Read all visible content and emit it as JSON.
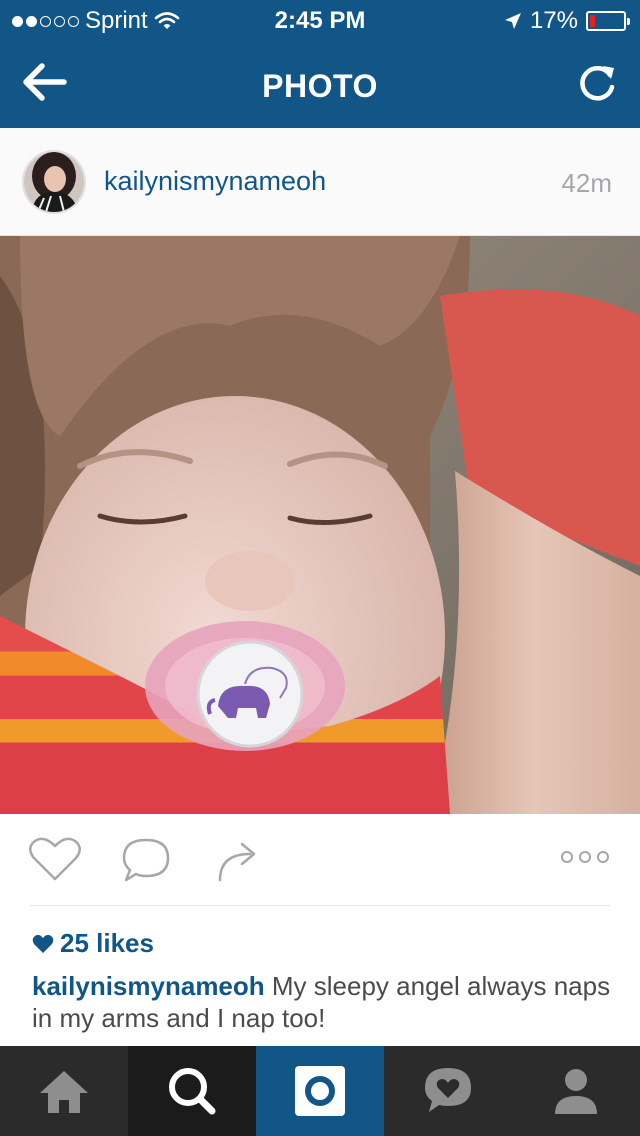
{
  "status_bar": {
    "carrier": "Sprint",
    "time": "2:45 PM",
    "battery_percent": "17%",
    "battery_level": 0.17,
    "signal_bars": 2
  },
  "nav": {
    "title": "PHOTO",
    "back_icon": "back-arrow-icon",
    "refresh_icon": "refresh-icon"
  },
  "post": {
    "username": "kailynismynameoh",
    "time_ago": "42m",
    "likes": "25 likes",
    "caption_user": "kailynismynameoh",
    "caption_text": "My sleepy angel always naps in my arms and I nap too!"
  },
  "actions": {
    "like_icon": "heart-outline-icon",
    "comment_icon": "comment-icon",
    "share_icon": "share-arrow-icon",
    "more_icon": "more-dots-icon"
  },
  "tabbar": {
    "items": [
      "home-icon",
      "search-icon",
      "camera-icon",
      "activity-heart-icon",
      "profile-icon"
    ],
    "active": "search"
  },
  "colors": {
    "brand": "#125688",
    "tabbar": "#2b2b2b",
    "battery_low": "#e52222"
  }
}
